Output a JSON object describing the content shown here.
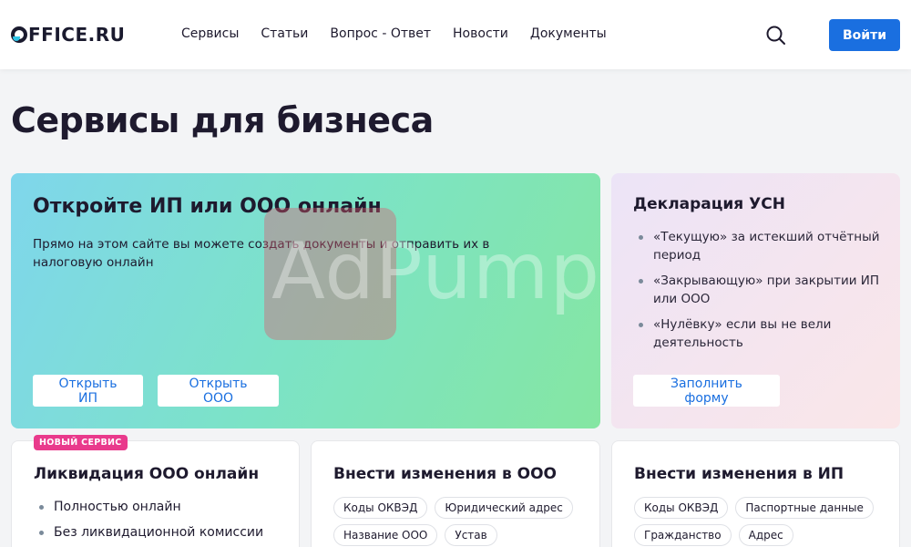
{
  "header": {
    "logo": "OFFICE.RU",
    "nav": [
      "Сервисы",
      "Статьи",
      "Вопрос - Ответ",
      "Новости",
      "Документы"
    ],
    "search_icon": "search-icon",
    "login_label": "Войти",
    "accent_color": "#1a6fe0"
  },
  "page": {
    "title": "Сервисы для бизнеса"
  },
  "card_ip": {
    "title": "Откройте ИП или ООО онлайн",
    "description": "Прямо на этом сайте вы можете создать документы и отправить их в налоговую онлайн",
    "btn_ip": "Открыть ИП",
    "btn_ooo": "Открыть ООО"
  },
  "card_usn": {
    "title": "Декларация УСН",
    "items": [
      "«Текущую» за истекший отчётный период",
      "«Закрывающую» при закрытии ИП или ООО",
      "«Нулёвку» если вы не вели деятельность"
    ],
    "btn": "Заполнить форму"
  },
  "watermark": "AdPump",
  "services": [
    {
      "badge": "НОВЫЙ СЕРВИС",
      "title": "Ликвидация ООО онлайн",
      "items": [
        "Полностью онлайн",
        "Без ликвидационной комиссии"
      ]
    },
    {
      "title": "Внести изменения в ООО",
      "tags": [
        "Коды ОКВЭД",
        "Юридический адрес",
        "Название ООО",
        "Устав"
      ]
    },
    {
      "title": "Внести изменения в ИП",
      "tags": [
        "Коды ОКВЭД",
        "Паспортные данные",
        "Гражданство",
        "Адрес"
      ]
    }
  ]
}
